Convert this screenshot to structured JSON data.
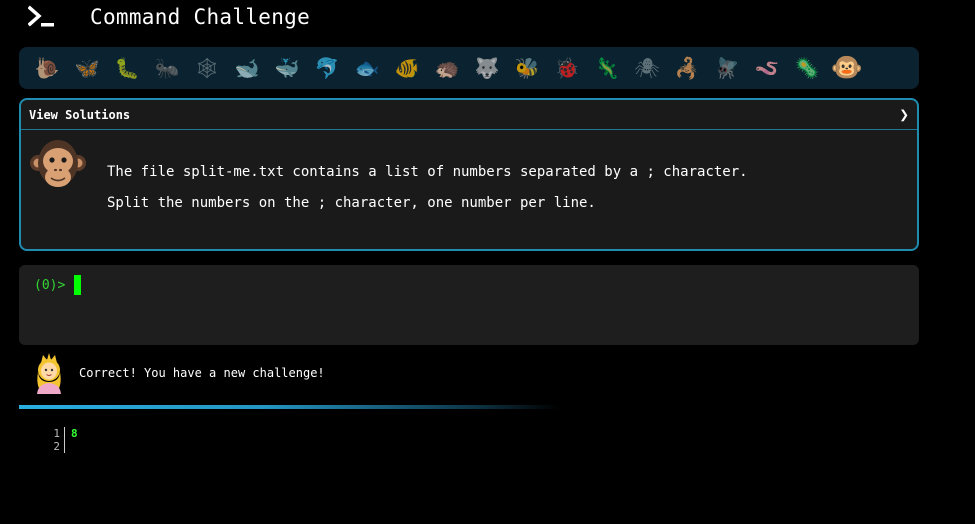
{
  "app": {
    "title": "Command Challenge"
  },
  "levels": [
    {
      "icon": "snail-icon",
      "glyph": "🐌"
    },
    {
      "icon": "butterfly-icon",
      "glyph": "🦋"
    },
    {
      "icon": "caterpillar-icon",
      "glyph": "🐛"
    },
    {
      "icon": "ant-icon",
      "glyph": "🐜"
    },
    {
      "icon": "spider-web-icon",
      "glyph": "🕸"
    },
    {
      "icon": "whale-icon",
      "glyph": "🐋"
    },
    {
      "icon": "spouting-whale-icon",
      "glyph": "🐳"
    },
    {
      "icon": "dolphin-icon",
      "glyph": "🐬"
    },
    {
      "icon": "fish-icon",
      "glyph": "🐟"
    },
    {
      "icon": "tropical-fish-icon",
      "glyph": "🐠"
    },
    {
      "icon": "hedgehog-icon",
      "glyph": "🦔"
    },
    {
      "icon": "wolf-icon",
      "glyph": "🐺"
    },
    {
      "icon": "bee-icon",
      "glyph": "🐝"
    },
    {
      "icon": "ladybug-icon",
      "glyph": "🐞"
    },
    {
      "icon": "lizard-icon",
      "glyph": "🦎"
    },
    {
      "icon": "spider-icon",
      "glyph": "🕷"
    },
    {
      "icon": "scorpion-icon",
      "glyph": "🦂"
    },
    {
      "icon": "fly-icon",
      "glyph": "🪰"
    },
    {
      "icon": "worm-icon",
      "glyph": "🪱"
    },
    {
      "icon": "microbe-icon",
      "glyph": "🦠"
    },
    {
      "icon": "monkey-icon",
      "glyph": "🐵"
    }
  ],
  "challenge": {
    "solutions_label": "View Solutions",
    "chevron": "❯",
    "line1": "The file split-me.txt contains a list of numbers separated by a ; character.",
    "line2": "Split the numbers on the ; character, one number per line."
  },
  "terminal": {
    "prompt": "(0)>"
  },
  "feedback": {
    "message": "Correct! You have a new challenge!"
  },
  "output": {
    "lines": [
      {
        "num": "1",
        "text": "8"
      },
      {
        "num": "2",
        "text": ""
      }
    ]
  },
  "colors": {
    "accent": "#1f8cb0",
    "level_bar_bg": "#0b2330",
    "prompt_green": "#33d633",
    "cursor_green": "#00ff00",
    "output_green": "#33ff33"
  }
}
